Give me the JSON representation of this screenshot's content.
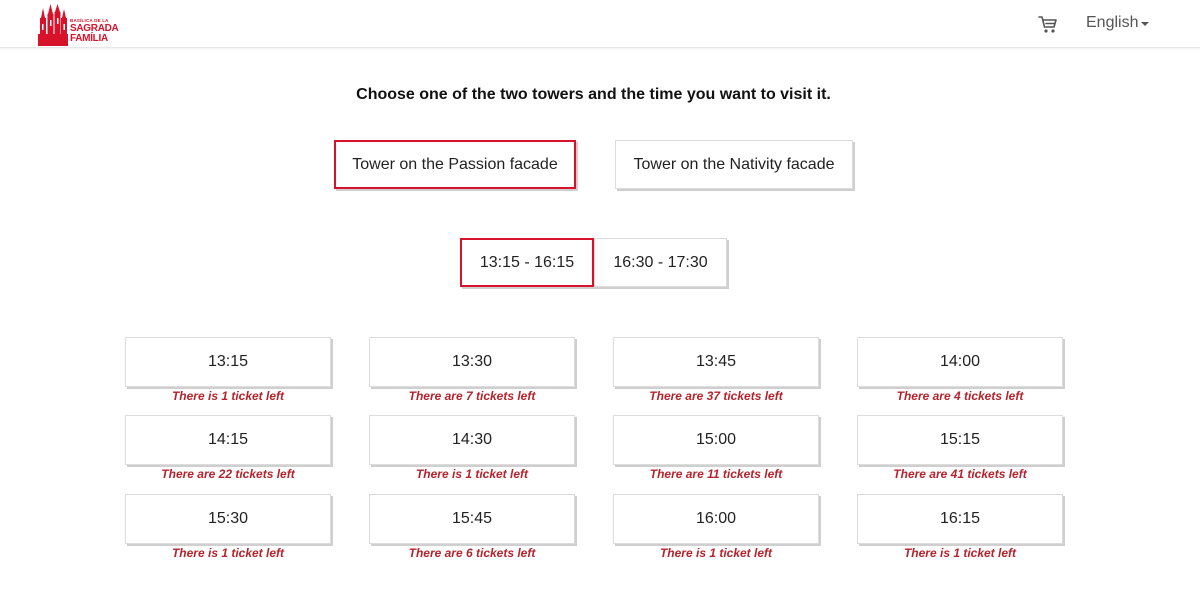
{
  "header": {
    "logo": {
      "line1": "BASÍLICA DE LA",
      "line2": "SAGRADA",
      "line3": "FAMÍLIA"
    },
    "cart_icon": "shopping-cart-icon",
    "language": "English"
  },
  "instruction": "Choose one of the two towers and the time you want to visit it.",
  "towers": [
    {
      "label": "Tower on the Passion facade",
      "selected": true
    },
    {
      "label": "Tower on the Nativity facade",
      "selected": false
    }
  ],
  "ranges": [
    {
      "label": "13:15 - 16:15",
      "selected": true
    },
    {
      "label": "16:30 - 17:30",
      "selected": false
    }
  ],
  "slots": [
    {
      "time": "13:15",
      "availability": "There is 1 ticket left"
    },
    {
      "time": "13:30",
      "availability": "There are 7 tickets left"
    },
    {
      "time": "13:45",
      "availability": "There are 37 tickets left"
    },
    {
      "time": "14:00",
      "availability": "There are 4 tickets left"
    },
    {
      "time": "14:15",
      "availability": "There are 22 tickets left"
    },
    {
      "time": "14:30",
      "availability": "There is 1 ticket left"
    },
    {
      "time": "15:00",
      "availability": "There are 11 tickets left"
    },
    {
      "time": "15:15",
      "availability": "There are 41 tickets left"
    },
    {
      "time": "15:30",
      "availability": "There is 1 ticket left"
    },
    {
      "time": "15:45",
      "availability": "There are 6 tickets left"
    },
    {
      "time": "16:00",
      "availability": "There is 1 ticket left"
    },
    {
      "time": "16:15",
      "availability": "There is 1 ticket left"
    }
  ],
  "colors": {
    "brand_red": "#d6132a",
    "availability_text": "#b3242d"
  }
}
